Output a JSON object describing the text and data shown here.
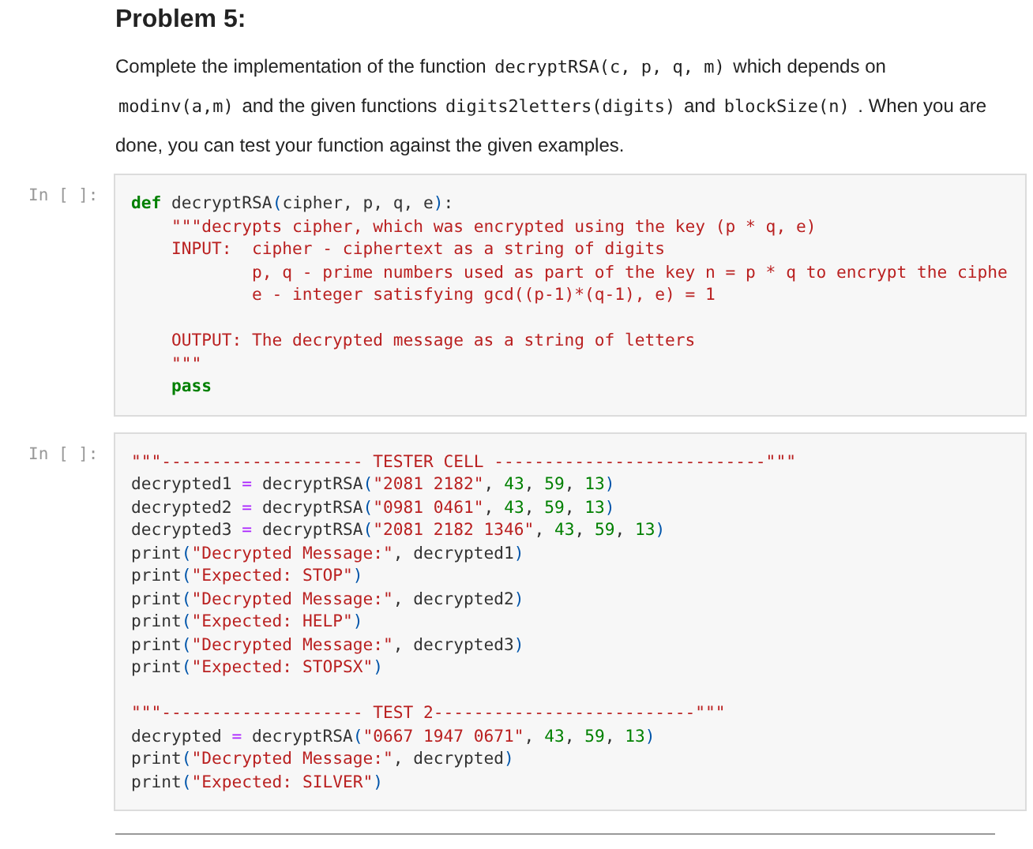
{
  "heading": "Problem 5:",
  "paragraph": [
    {
      "kind": "text",
      "text": "Complete the implementation of the function "
    },
    {
      "kind": "code",
      "text": "decryptRSA(c, p, q, m)"
    },
    {
      "kind": "text",
      "text": " which depends on "
    },
    {
      "kind": "code",
      "text": "modinv(a,m)"
    },
    {
      "kind": "text",
      "text": " and the given functions "
    },
    {
      "kind": "code",
      "text": "digits2letters(digits)"
    },
    {
      "kind": "text",
      "text": " and "
    },
    {
      "kind": "code",
      "text": "blockSize(n)"
    },
    {
      "kind": "text",
      "text": " . When you are done, you can test your function against the given examples."
    }
  ],
  "cells": [
    {
      "prompt": "In [ ]:",
      "lines": [
        {
          "kind": "code",
          "tokens": [
            {
              "kind": "kw",
              "text": "def"
            },
            {
              "kind": "plain",
              "text": " decryptRSA"
            },
            {
              "kind": "paren",
              "text": "("
            },
            {
              "kind": "plain",
              "text": "cipher, p, q, e"
            },
            {
              "kind": "paren",
              "text": ")"
            },
            {
              "kind": "plain",
              "text": ":"
            }
          ]
        },
        {
          "kind": "code",
          "tokens": [
            {
              "kind": "str",
              "text": "    \"\"\"decrypts cipher, which was encrypted using the key (p * q, e)"
            }
          ]
        },
        {
          "kind": "code",
          "tokens": [
            {
              "kind": "str",
              "text": "    INPUT:  cipher - ciphertext as a string of digits"
            }
          ]
        },
        {
          "kind": "code",
          "tokens": [
            {
              "kind": "str",
              "text": "            p, q - prime numbers used as part of the key n = p * q to encrypt the ciphe"
            }
          ]
        },
        {
          "kind": "code",
          "tokens": [
            {
              "kind": "str",
              "text": "            e - integer satisfying gcd((p-1)*(q-1), e) = 1"
            }
          ]
        },
        {
          "kind": "blank"
        },
        {
          "kind": "code",
          "tokens": [
            {
              "kind": "str",
              "text": "    OUTPUT: The decrypted message as a string of letters"
            }
          ]
        },
        {
          "kind": "code",
          "tokens": [
            {
              "kind": "str",
              "text": "    \"\"\""
            }
          ]
        },
        {
          "kind": "code",
          "tokens": [
            {
              "kind": "kw",
              "text": "    pass"
            }
          ]
        }
      ]
    },
    {
      "prompt": "In [ ]:",
      "lines": [
        {
          "kind": "code",
          "tokens": [
            {
              "kind": "str",
              "text": "\"\"\"-------------------- TESTER CELL ---------------------------\"\"\""
            }
          ]
        },
        {
          "kind": "code",
          "tokens": [
            {
              "kind": "plain",
              "text": "decrypted1 "
            },
            {
              "kind": "op",
              "text": "="
            },
            {
              "kind": "plain",
              "text": " decryptRSA"
            },
            {
              "kind": "paren",
              "text": "("
            },
            {
              "kind": "str",
              "text": "\"2081 2182\""
            },
            {
              "kind": "plain",
              "text": ", "
            },
            {
              "kind": "num",
              "text": "43"
            },
            {
              "kind": "plain",
              "text": ", "
            },
            {
              "kind": "num",
              "text": "59"
            },
            {
              "kind": "plain",
              "text": ", "
            },
            {
              "kind": "num",
              "text": "13"
            },
            {
              "kind": "paren",
              "text": ")"
            }
          ]
        },
        {
          "kind": "code",
          "tokens": [
            {
              "kind": "plain",
              "text": "decrypted2 "
            },
            {
              "kind": "op",
              "text": "="
            },
            {
              "kind": "plain",
              "text": " decryptRSA"
            },
            {
              "kind": "paren",
              "text": "("
            },
            {
              "kind": "str",
              "text": "\"0981 0461\""
            },
            {
              "kind": "plain",
              "text": ", "
            },
            {
              "kind": "num",
              "text": "43"
            },
            {
              "kind": "plain",
              "text": ", "
            },
            {
              "kind": "num",
              "text": "59"
            },
            {
              "kind": "plain",
              "text": ", "
            },
            {
              "kind": "num",
              "text": "13"
            },
            {
              "kind": "paren",
              "text": ")"
            }
          ]
        },
        {
          "kind": "code",
          "tokens": [
            {
              "kind": "plain",
              "text": "decrypted3 "
            },
            {
              "kind": "op",
              "text": "="
            },
            {
              "kind": "plain",
              "text": " decryptRSA"
            },
            {
              "kind": "paren",
              "text": "("
            },
            {
              "kind": "str",
              "text": "\"2081 2182 1346\""
            },
            {
              "kind": "plain",
              "text": ", "
            },
            {
              "kind": "num",
              "text": "43"
            },
            {
              "kind": "plain",
              "text": ", "
            },
            {
              "kind": "num",
              "text": "59"
            },
            {
              "kind": "plain",
              "text": ", "
            },
            {
              "kind": "num",
              "text": "13"
            },
            {
              "kind": "paren",
              "text": ")"
            }
          ]
        },
        {
          "kind": "code",
          "tokens": [
            {
              "kind": "plain",
              "text": "print"
            },
            {
              "kind": "paren",
              "text": "("
            },
            {
              "kind": "str",
              "text": "\"Decrypted Message:\""
            },
            {
              "kind": "plain",
              "text": ", decrypted1"
            },
            {
              "kind": "paren",
              "text": ")"
            }
          ]
        },
        {
          "kind": "code",
          "tokens": [
            {
              "kind": "plain",
              "text": "print"
            },
            {
              "kind": "paren",
              "text": "("
            },
            {
              "kind": "str",
              "text": "\"Expected: STOP\""
            },
            {
              "kind": "paren",
              "text": ")"
            }
          ]
        },
        {
          "kind": "code",
          "tokens": [
            {
              "kind": "plain",
              "text": "print"
            },
            {
              "kind": "paren",
              "text": "("
            },
            {
              "kind": "str",
              "text": "\"Decrypted Message:\""
            },
            {
              "kind": "plain",
              "text": ", decrypted2"
            },
            {
              "kind": "paren",
              "text": ")"
            }
          ]
        },
        {
          "kind": "code",
          "tokens": [
            {
              "kind": "plain",
              "text": "print"
            },
            {
              "kind": "paren",
              "text": "("
            },
            {
              "kind": "str",
              "text": "\"Expected: HELP\""
            },
            {
              "kind": "paren",
              "text": ")"
            }
          ]
        },
        {
          "kind": "code",
          "tokens": [
            {
              "kind": "plain",
              "text": "print"
            },
            {
              "kind": "paren",
              "text": "("
            },
            {
              "kind": "str",
              "text": "\"Decrypted Message:\""
            },
            {
              "kind": "plain",
              "text": ", decrypted3"
            },
            {
              "kind": "paren",
              "text": ")"
            }
          ]
        },
        {
          "kind": "code",
          "tokens": [
            {
              "kind": "plain",
              "text": "print"
            },
            {
              "kind": "paren",
              "text": "("
            },
            {
              "kind": "str",
              "text": "\"Expected: STOPSX\""
            },
            {
              "kind": "paren",
              "text": ")"
            }
          ]
        },
        {
          "kind": "blank"
        },
        {
          "kind": "code",
          "tokens": [
            {
              "kind": "str",
              "text": "\"\"\"-------------------- TEST 2--------------------------\"\"\""
            }
          ]
        },
        {
          "kind": "code",
          "tokens": [
            {
              "kind": "plain",
              "text": "decrypted "
            },
            {
              "kind": "op",
              "text": "="
            },
            {
              "kind": "plain",
              "text": " decryptRSA"
            },
            {
              "kind": "paren",
              "text": "("
            },
            {
              "kind": "str",
              "text": "\"0667 1947 0671\""
            },
            {
              "kind": "plain",
              "text": ", "
            },
            {
              "kind": "num",
              "text": "43"
            },
            {
              "kind": "plain",
              "text": ", "
            },
            {
              "kind": "num",
              "text": "59"
            },
            {
              "kind": "plain",
              "text": ", "
            },
            {
              "kind": "num",
              "text": "13"
            },
            {
              "kind": "paren",
              "text": ")"
            }
          ]
        },
        {
          "kind": "code",
          "tokens": [
            {
              "kind": "plain",
              "text": "print"
            },
            {
              "kind": "paren",
              "text": "("
            },
            {
              "kind": "str",
              "text": "\"Decrypted Message:\""
            },
            {
              "kind": "plain",
              "text": ", decrypted"
            },
            {
              "kind": "paren",
              "text": ")"
            }
          ]
        },
        {
          "kind": "code",
          "tokens": [
            {
              "kind": "plain",
              "text": "print"
            },
            {
              "kind": "paren",
              "text": "("
            },
            {
              "kind": "str",
              "text": "\"Expected: SILVER\""
            },
            {
              "kind": "paren",
              "text": ")"
            }
          ]
        }
      ]
    }
  ]
}
